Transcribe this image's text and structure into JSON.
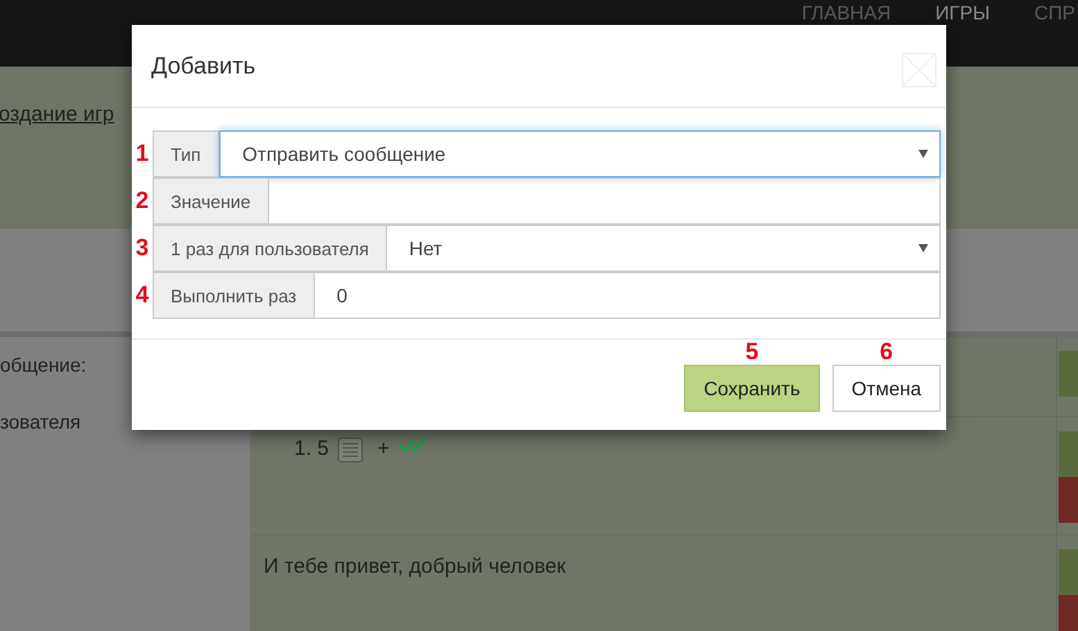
{
  "navbar": {
    "items": [
      {
        "label": "ГЛАВНАЯ",
        "selected": false
      },
      {
        "label": "ИГРЫ",
        "selected": true
      },
      {
        "label": "СПР",
        "selected": false
      }
    ]
  },
  "breadcrumb": {
    "link": "оздание игр"
  },
  "left_labels": [
    "общение:",
    "зователя"
  ],
  "rows": [
    {
      "kind": "buttons"
    },
    {
      "kind": "item",
      "number": "1. 5",
      "plus": "+"
    },
    {
      "kind": "message",
      "text": "И тебе привет, добрый человек"
    }
  ],
  "dialog": {
    "title": "Добавить",
    "fields": [
      {
        "mark": "1",
        "label": "Тип",
        "kind": "select",
        "value": "Отправить сообщение",
        "focused": true
      },
      {
        "mark": "2",
        "label": "Значение",
        "kind": "input",
        "focused": false
      },
      {
        "mark": "3",
        "label": "1 раз для пользователя",
        "kind": "select",
        "value": "Нет",
        "focused": false
      },
      {
        "mark": "4",
        "label": "Выполнить раз",
        "kind": "input",
        "value": "0",
        "focused": false
      }
    ],
    "buttons": [
      {
        "mark": "5",
        "label": "Сохранить",
        "kind": "primary"
      },
      {
        "mark": "6",
        "label": "Отмена",
        "kind": "default"
      }
    ]
  }
}
